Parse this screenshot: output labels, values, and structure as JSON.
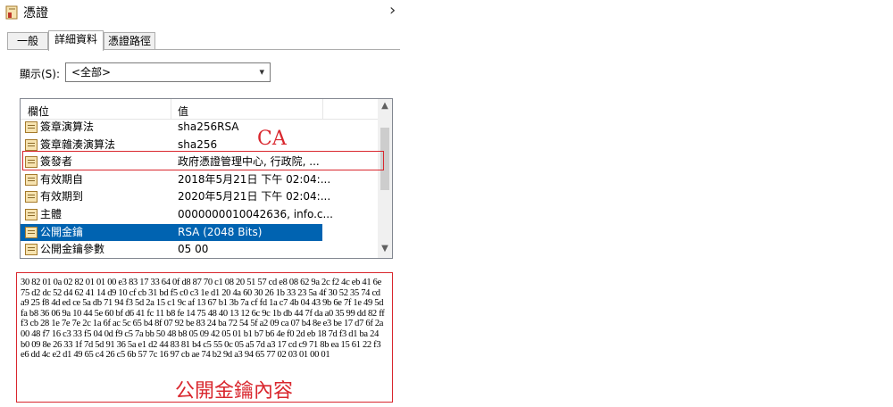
{
  "window": {
    "title": "憑證",
    "close_glyph": "›"
  },
  "tabs": [
    {
      "label": "一般"
    },
    {
      "label": "詳細資料"
    },
    {
      "label": "憑證路徑"
    }
  ],
  "show": {
    "label": "顯示(S):",
    "value": "<全部>"
  },
  "list": {
    "col_field": "欄位",
    "col_value": "值",
    "rows": [
      {
        "field": "簽章演算法",
        "value": "sha256RSA"
      },
      {
        "field": "簽章雜湊演算法",
        "value": "sha256"
      },
      {
        "field": "簽發者",
        "value": "政府憑證管理中心, 行政院, ..."
      },
      {
        "field": "有效期自",
        "value": "2018年5月21日 下午 02:04:..."
      },
      {
        "field": "有效期到",
        "value": "2020年5月21日 下午 02:04:..."
      },
      {
        "field": "主體",
        "value": "0000000010042636, info.c..."
      },
      {
        "field": "公開金鑰",
        "value": "RSA (2048 Bits)"
      },
      {
        "field": "公開金鑰參數",
        "value": "05 00"
      }
    ],
    "selected_index": 6
  },
  "annotations": {
    "ca": "CA",
    "key_content": "公開金鑰內容"
  },
  "key_hex": "30 82 01 0a 02 82 01 01 00 e3 83 17 33 64 0f d8 87 70 c1 08 20 51 57 cd e8 08 62 9a 2c f2 4c eb 41 6e 75 d2 dc 52 d4 62 41 14 d9 10 cf cb 31 bd f5 c0 c3 1e d1 20 4a 60 30 26 1b 33 23 5a 4f 30 52 35 74 cd a9 25 f8 4d ed ce 5a db 71 94 f3 5d 2a 15 c1 9c af 13 67 b1 3b 7a cf fd 1a c7 4b 04 43 9b 6e 7f 1e 49 5d fa b8 36 06 9a 10 44 5e 60 bf d6 41 fc 11 b8 fe 14 75 48 40 13 12 6c 9c 1b db 44 7f da a0 35 99 dd 82 ff f3 cb 28 1e 7e 7e 2c 1a 6f ac 5c 65 b4 8f 07 92 be 83 24 ba 72 54 5f a2 09 ca 07 b4 8e e3 be 17 d7 6f 2a 00 48 f7 16 c3 33 f5 04 0d f9 c5 7a bb 50 48 b8 05 09 42 05 01 b1 b7 b6 4e f0 2d eb 18 7d f3 d1 ba 24 b0 09 8e 26 33 1f 7d 5d 91 36 5a e1 d2 44 83 81 b4 c5 55 0c 05 a5 7d a3 17 cd c9 71 8b ea 15 61 22 f3 e6 dd 4c e2 d1 49 65 c4 26 c5 6b 57 7c 16 97 cb ae 74 b2 9d a3 94 65 77 02 03 01 00 01",
  "colors": {
    "annotation_red": "#d9272e",
    "selection_blue": "#0063b1"
  }
}
